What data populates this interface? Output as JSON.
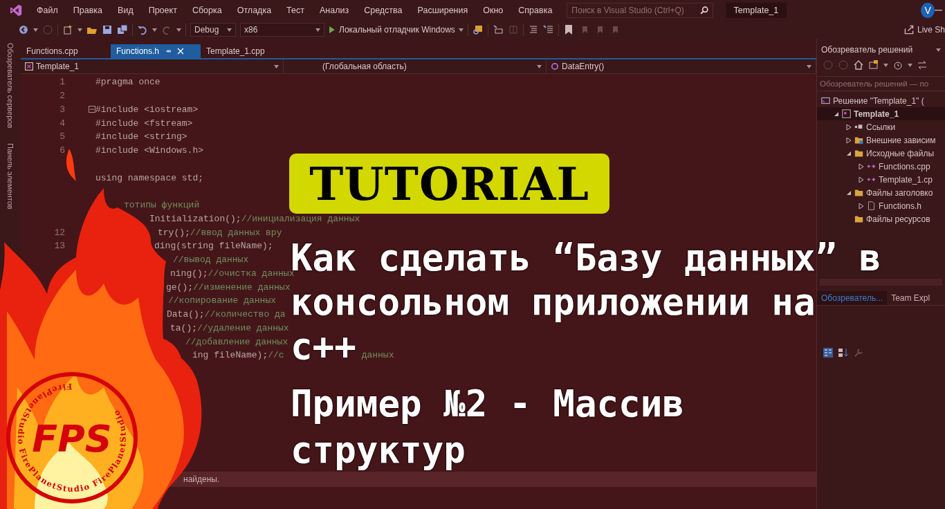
{
  "menu_bar": {
    "items": [
      "Файл",
      "Правка",
      "Вид",
      "Проект",
      "Сборка",
      "Отладка",
      "Тест",
      "Анализ",
      "Средства",
      "Расширения",
      "Окно",
      "Справка"
    ],
    "search": {
      "placeholder": "Поиск в Visual Studio (Ctrl+Q)"
    },
    "solution_name": "Template_1",
    "account": {
      "initial": "V"
    }
  },
  "toolbar": {
    "configuration": "Debug",
    "platform": "x86",
    "run_target": "Локальный отладчик Windows",
    "live_share": "Live Sh"
  },
  "side_strip": {
    "items": [
      "Обозреватель серверов",
      "Панель элементов"
    ]
  },
  "editor": {
    "tabs": [
      {
        "label": "Functions.cpp",
        "selected": false
      },
      {
        "label": "Functions.h",
        "selected": true
      },
      {
        "label": "Template_1.cpp",
        "selected": false
      }
    ],
    "nav_bar": {
      "project": "Template_1",
      "scope": "(Глобальная область)",
      "member": "DataEntry()"
    },
    "lines": [
      {
        "number": "1",
        "code": "#pragma once"
      },
      {
        "number": "2"
      },
      {
        "number": "3",
        "code": "#include <iostream>",
        "fold": true
      },
      {
        "number": "4",
        "code": "#include <fstream>"
      },
      {
        "number": "5",
        "code": "#include <string>"
      },
      {
        "number": "6",
        "code": "#include <Windows.h>"
      },
      {
        "code": "using namespace std;"
      },
      {
        "comment": "тотипы функций"
      },
      {
        "code": "Initialization();",
        "comment": "//инициализация данных"
      },
      {
        "number": "12",
        "code": "try();",
        "comment": "//ввод данных вру"
      },
      {
        "number": "13",
        "code": "ding(string fileName);"
      },
      {
        "comment": "//вывод данных"
      },
      {
        "code": "ning();",
        "comment": "//очистка данных"
      },
      {
        "code": "ge();",
        "comment": "//изменение данных"
      },
      {
        "comment": "//копирование данных"
      },
      {
        "code": "Data();",
        "comment": "//количество да"
      },
      {
        "code": "ta();",
        "comment": "//удаление данных"
      },
      {
        "comment": "//добавление данных"
      },
      {
        "code": "ing fileName);",
        "comment": "//с",
        "comment_tail": "данных"
      }
    ]
  },
  "output_panel": {
    "message": "найдены."
  },
  "solution_explorer": {
    "title": "Обозреватель решений",
    "search": {
      "placeholder": "Обозреватель решений — по"
    },
    "tree": [
      {
        "label": "Решение \"Template_1\" (",
        "kind": "solution",
        "selected": false,
        "children": [
          {
            "label": "Template_1",
            "kind": "project",
            "expanded": true,
            "selected": true,
            "children": [
              {
                "label": "Ссылки",
                "kind": "references",
                "expanded": false,
                "selected": false
              },
              {
                "label": "Внешние зависим",
                "kind": "external",
                "expanded": false,
                "selected": false
              },
              {
                "label": "Исходные файлы",
                "kind": "folder",
                "expanded": true,
                "selected": false,
                "children": [
                  {
                    "label": "Functions.cpp",
                    "kind": "cpp",
                    "expanded": false,
                    "selected": false
                  },
                  {
                    "label": "Template_1.cp",
                    "kind": "cpp",
                    "expanded": false,
                    "selected": false
                  }
                ]
              },
              {
                "label": "Файлы заголовко",
                "kind": "folder",
                "expanded": true,
                "selected": false,
                "children": [
                  {
                    "label": "Functions.h",
                    "kind": "header",
                    "expanded": false,
                    "selected": false
                  }
                ]
              },
              {
                "label": "Файлы ресурсов",
                "kind": "folder",
                "selected": false
              }
            ]
          }
        ]
      }
    ],
    "tabs": [
      {
        "label": "Обозреватель...",
        "selected": true
      },
      {
        "label": "Team Expl",
        "selected": false
      }
    ]
  },
  "overlay": {
    "badge": "TUTORIAL",
    "title_lines": [
      "Как сделать “Базу данных” в",
      "консольном приложении на",
      "c++"
    ],
    "subtitle_lines": [
      "Пример №2 - Массив",
      "структур"
    ]
  },
  "logo": {
    "monogram": "FPS",
    "ring_text": "FirePlanetStudio  FirePlanetStudio  FirePlanetStudio"
  }
}
